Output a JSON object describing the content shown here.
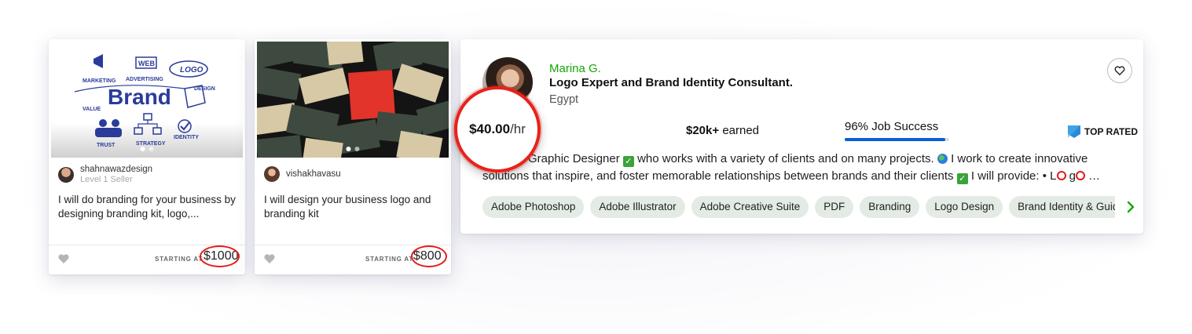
{
  "gigs": [
    {
      "seller_name": "shahnawazdesign",
      "seller_level": "Level 1 Seller",
      "title": "I will do branding for your business by designing branding kit, logo,...",
      "starting_label": "STARTING AT",
      "price": "$1000",
      "image_words": {
        "brand": "Brand",
        "marketing": "MARKETING",
        "advertising": "ADVERTISING",
        "web": "WEB",
        "logo": "LOGO",
        "design": "DESIGN",
        "value": "VALUE",
        "trust": "TRUST",
        "strategy": "STRATEGY",
        "identity": "IDENTITY"
      }
    },
    {
      "seller_name": "vishakhavasu",
      "title": "I will design your business logo and branding kit",
      "starting_label": "STARTING AT",
      "price": "$800"
    }
  ],
  "freelancer": {
    "name": "Marina G.",
    "title": "Logo Expert and Brand Identity Consultant.",
    "location": "Egypt",
    "rate": "$40.00",
    "rate_unit": "/hr",
    "earned_amount": "$20k+",
    "earned_label": "earned",
    "job_success": "96% Job Success",
    "job_success_fraction": 0.96,
    "badge": "TOP RATED",
    "description_line1_a": "Graphic Designer",
    "description_line1_b": " who works with a variety of clients and on many projects.",
    "description_line1_c": " I work to create innovative",
    "description_line2_a": "solutions that inspire, and foster memorable relationships between brands and their clients",
    "description_line2_b": " I will provide: • L",
    "description_line2_c": " g",
    "description_line2_d": " …",
    "skills": [
      "Adobe Photoshop",
      "Adobe Illustrator",
      "Adobe Creative Suite",
      "PDF",
      "Branding",
      "Logo Design",
      "Brand Identity & Guidelines"
    ]
  },
  "colors": {
    "brand_green": "#14a800",
    "highlight_red": "#e21b1b",
    "progress_blue": "#0a5ed7",
    "skill_bg": "#e4ebe4"
  }
}
